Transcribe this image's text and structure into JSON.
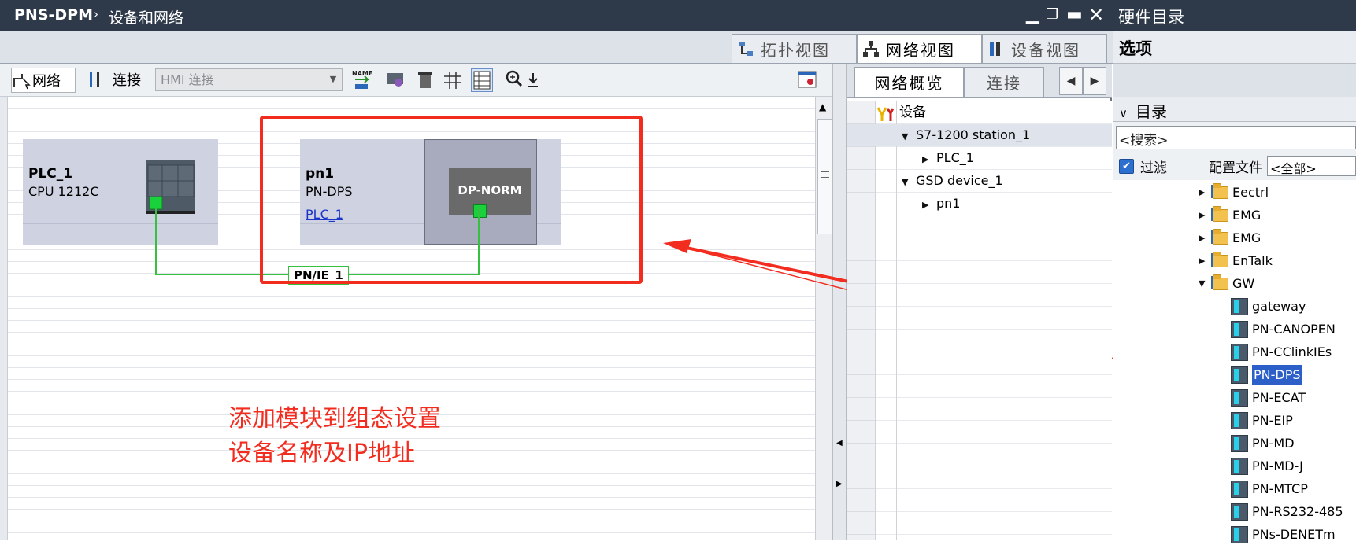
{
  "title_bar": {
    "project": "PNS-DPM",
    "separator": "›",
    "section": "设备和网络"
  },
  "view_tabs": [
    "拓扑视图",
    "网络视图",
    "设备视图"
  ],
  "toolbar": {
    "network_label": "网络",
    "connect_label": "连接",
    "connection_type": "HMI 连接"
  },
  "devices": [
    {
      "name": "PLC_1",
      "type": "CPU 1212C"
    },
    {
      "name": "pn1",
      "type": "PN-DPS",
      "link": "PLC_1",
      "module_label": "DP-NORM"
    }
  ],
  "subnet_label": "PN/IE_1",
  "annotation": {
    "line1": "添加模块到组态设置",
    "line2": "设备名称及IP地址"
  },
  "overview": {
    "tabs": [
      "网络概览",
      "连接"
    ],
    "header": "设备",
    "rows": [
      {
        "label": "S7-1200 station_1",
        "expanded": true,
        "level": 0
      },
      {
        "label": "PLC_1",
        "expanded": false,
        "level": 1
      },
      {
        "label": "GSD device_1",
        "expanded": true,
        "level": 0
      },
      {
        "label": "pn1",
        "expanded": false,
        "level": 1
      }
    ]
  },
  "catalog": {
    "title": "硬件目录",
    "options": "选项",
    "directory": "目录",
    "search_placeholder": "<搜索>",
    "filter_label": "过滤",
    "profile_label": "配置文件",
    "profile_value": "<全部>",
    "folders": [
      "Eectrl",
      "EMG",
      "EMG",
      "EnTalk",
      "GW"
    ],
    "gw_items": [
      "gateway",
      "PN-CANOPEN",
      "PN-CClinkIEs",
      "PN-DPS",
      "PN-ECAT",
      "PN-EIP",
      "PN-MD",
      "PN-MD-J",
      "PN-MTCP",
      "PN-RS232-485",
      "PNs-DENETm"
    ],
    "selected": "PN-DPS"
  },
  "colors": {
    "annotation": "#f22d1f",
    "title_bar": "#2e3a4a",
    "device_box": "#cfd3e1",
    "connection": "#35c13f"
  }
}
